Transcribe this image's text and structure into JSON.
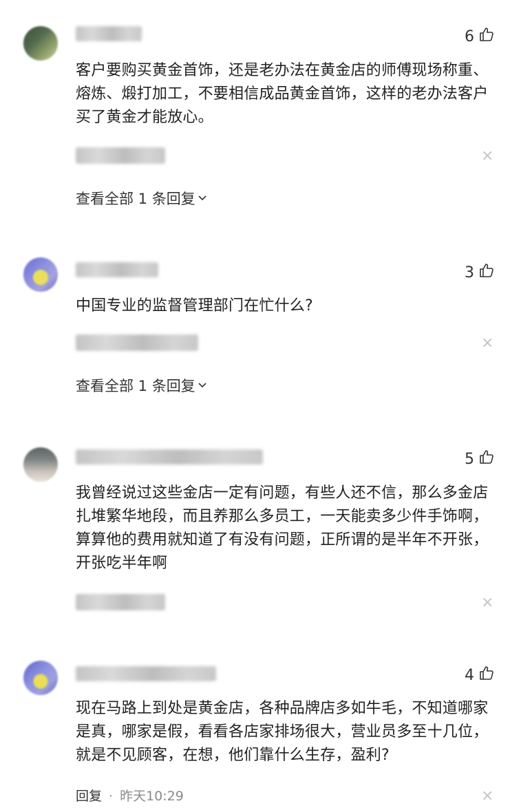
{
  "comments": [
    {
      "username": "██████",
      "likes": "6",
      "text": "客户要购买黄金首饰，还是老办法在黄金店的师傅现场称重、熔炼、煅打加工，不要相信成品黄金首饰，这样的老办法客户买了黄金才能放心。",
      "view_all": "查看全部 1 条回复"
    },
    {
      "username": "████████",
      "likes": "3",
      "text": "中国专业的监督管理部门在忙什么?",
      "view_all": "查看全部 1 条回复"
    },
    {
      "username": "████████████████",
      "likes": "5",
      "text": "我曾经说过这些金店一定有问题，有些人还不信，那么多金店扎堆繁华地段，而且养那么多员工，一天能卖多少件手饰啊，算算他的费用就知道了有没有问题，正所谓的是半年不开张，开张吃半年啊"
    },
    {
      "username": "████████████",
      "likes": "4",
      "text": "现在马路上到处是黄金店，各种品牌店多如牛毛，不知道哪家是真，哪家是假，看看各店家排场很大，营业员多至十几位，就是不见顾客，在想，他们靠什么生存，盈利?",
      "reply_label": "回复",
      "separator": "·",
      "time": "昨天10:29"
    }
  ],
  "icons": {
    "like": "thumbs-up-icon",
    "close": "close-icon",
    "chevron": "chevron-down-icon"
  }
}
